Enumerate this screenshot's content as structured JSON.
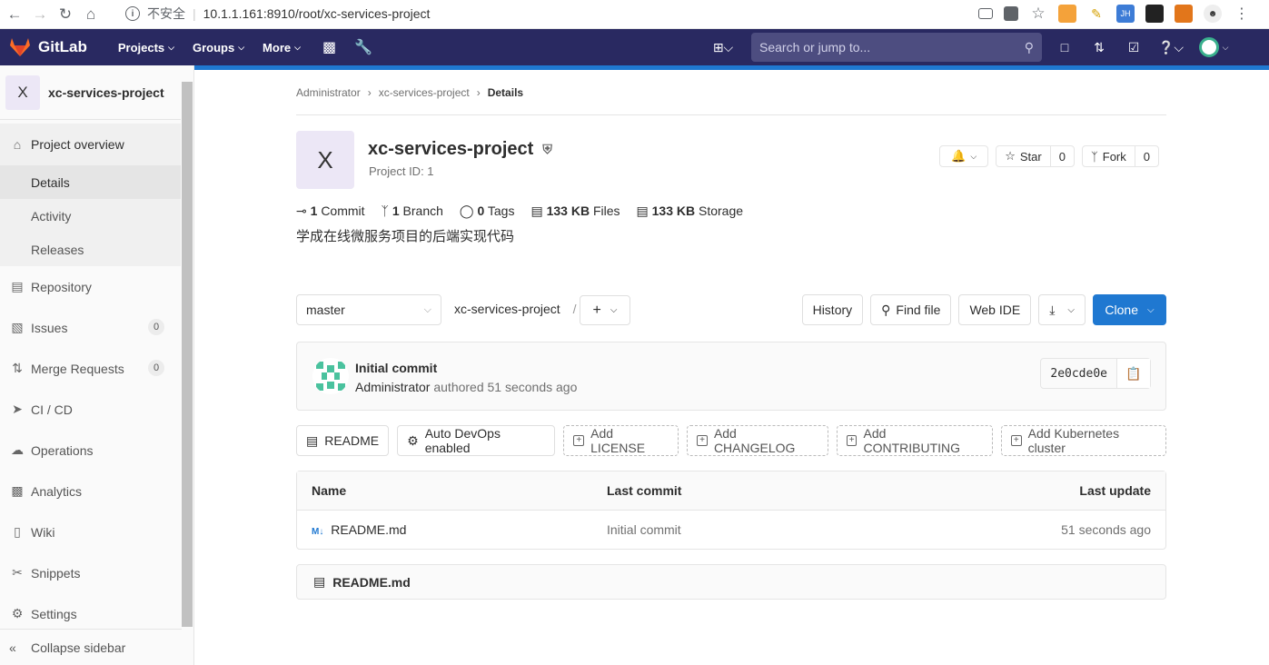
{
  "browser": {
    "insecure_label": "不安全",
    "url": "10.1.1.161:8910/root/xc-services-project"
  },
  "header": {
    "brand": "GitLab",
    "nav": [
      "Projects",
      "Groups",
      "More"
    ],
    "search_placeholder": "Search or jump to..."
  },
  "sidebar": {
    "project_initial": "X",
    "project_name": "xc-services-project",
    "overview": "Project overview",
    "sub_items": [
      "Details",
      "Activity",
      "Releases"
    ],
    "items": [
      {
        "label": "Repository",
        "icon": "doc-icon"
      },
      {
        "label": "Issues",
        "icon": "issues-icon",
        "count": "0"
      },
      {
        "label": "Merge Requests",
        "icon": "merge-icon",
        "count": "0"
      },
      {
        "label": "CI / CD",
        "icon": "rocket-icon"
      },
      {
        "label": "Operations",
        "icon": "cloud-icon"
      },
      {
        "label": "Analytics",
        "icon": "chart-icon"
      },
      {
        "label": "Wiki",
        "icon": "book-icon"
      },
      {
        "label": "Snippets",
        "icon": "scissors-icon"
      },
      {
        "label": "Settings",
        "icon": "gear-icon"
      }
    ],
    "collapse": "Collapse sidebar"
  },
  "breadcrumb": [
    "Administrator",
    "xc-services-project",
    "Details"
  ],
  "project": {
    "initial": "X",
    "title": "xc-services-project",
    "id_text": "Project ID: 1",
    "star": "Star",
    "star_count": "0",
    "fork": "Fork",
    "fork_count": "0",
    "description": "学成在线微服务项目的后端实现代码"
  },
  "stats": {
    "commits_n": "1",
    "commits_l": "Commit",
    "branches_n": "1",
    "branches_l": "Branch",
    "tags_n": "0",
    "tags_l": "Tags",
    "files_n": "133 KB",
    "files_l": "Files",
    "storage_n": "133 KB",
    "storage_l": "Storage"
  },
  "toolbar": {
    "branch": "master",
    "path": "xc-services-project",
    "slash": "/",
    "history": "History",
    "find_file": "Find file",
    "web_ide": "Web IDE",
    "clone": "Clone"
  },
  "commit": {
    "title": "Initial commit",
    "author": "Administrator",
    "authored": "authored 51 seconds ago",
    "sha": "2e0cde0e"
  },
  "quick_buttons": {
    "readme": "README",
    "auto_devops": "Auto DevOps enabled",
    "license": "Add LICENSE",
    "changelog": "Add CHANGELOG",
    "contributing": "Add CONTRIBUTING",
    "kubernetes": "Add Kubernetes cluster"
  },
  "tree": {
    "headers": [
      "Name",
      "Last commit",
      "Last update"
    ],
    "rows": [
      {
        "name": "README.md",
        "commit": "Initial commit",
        "updated": "51 seconds ago"
      }
    ]
  },
  "readme_file": "README.md",
  "colors": {
    "header_bg": "#292961",
    "accent": "#1f78d1",
    "avatar_bg": "#ece7f6"
  }
}
